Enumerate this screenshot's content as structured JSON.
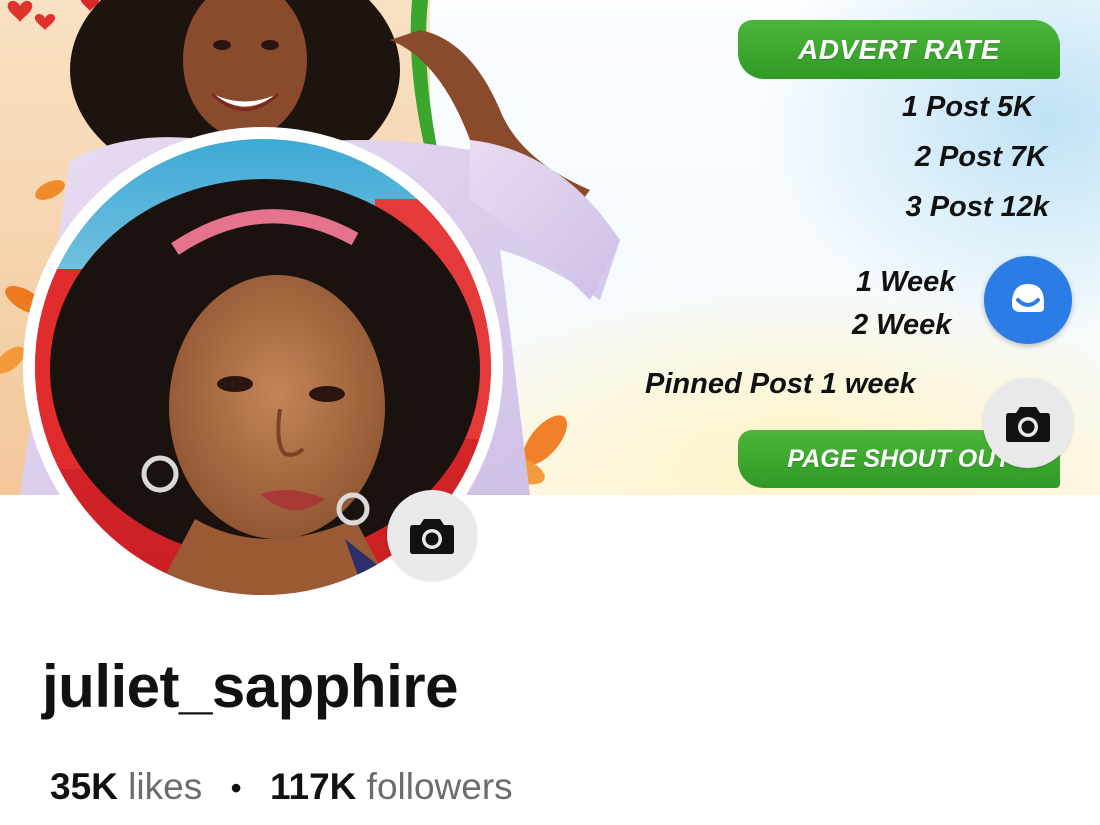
{
  "cover": {
    "advert_title": "ADVERT RATE",
    "rates": [
      "1 Post 5K",
      "2 Post 7K",
      "3 Post 12k",
      "1 Week",
      "2 Week",
      "Pinned Post 1 week"
    ],
    "shout_title": "PAGE SHOUT OUT"
  },
  "profile": {
    "username": "juliet_sapphire",
    "likes_count": "35K",
    "likes_label": "likes",
    "separator": "•",
    "followers_count": "117K",
    "followers_label": "followers"
  },
  "icons": {
    "assistant": "assistant-chat-icon",
    "cover_camera": "camera-icon",
    "avatar_camera": "camera-icon"
  },
  "colors": {
    "green_banner": "#3aa62e",
    "assistant_blue": "#2b7ce5",
    "camera_button_bg": "#e9e9ec",
    "muted_text": "#6b6b70"
  }
}
